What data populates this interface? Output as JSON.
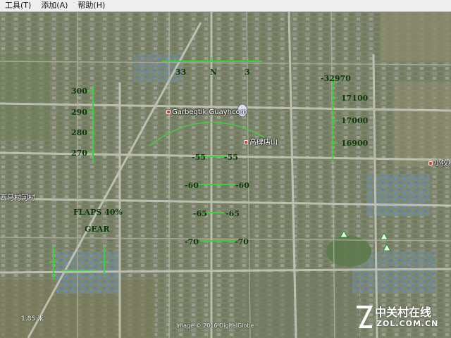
{
  "menu": {
    "items": [
      "工具(T)",
      "添加(A)",
      "帮助(H)"
    ]
  },
  "hud": {
    "heading": {
      "left": "33",
      "center": "N",
      "right": "3"
    },
    "speed": [
      "300",
      "290",
      "280",
      "270"
    ],
    "altitude": [
      "-32970",
      "17100",
      "17000",
      "16900"
    ],
    "pitch_labels": {
      "l55": "-55",
      "r55": "-55",
      "l60": "-60",
      "r60": "-60",
      "l65": "-65",
      "r65": "-65",
      "l70": "-70",
      "r70": "-70"
    },
    "flaps": "FLAPS 40%",
    "gear": "GEAR"
  },
  "places": {
    "a": "Garbegtik Guayhcom",
    "b": "高碑店山",
    "c": "西马村河村",
    "d": "小牧村"
  },
  "status": {
    "altitude": "1.85 米"
  },
  "attribution": "Image © 2016 DigitalGlobe",
  "watermark": {
    "cn": "中关村在线",
    "en": "ZOL.COM.CN"
  },
  "colors": {
    "hud": "#3ed13e",
    "hud_text": "#0b3a0b"
  }
}
